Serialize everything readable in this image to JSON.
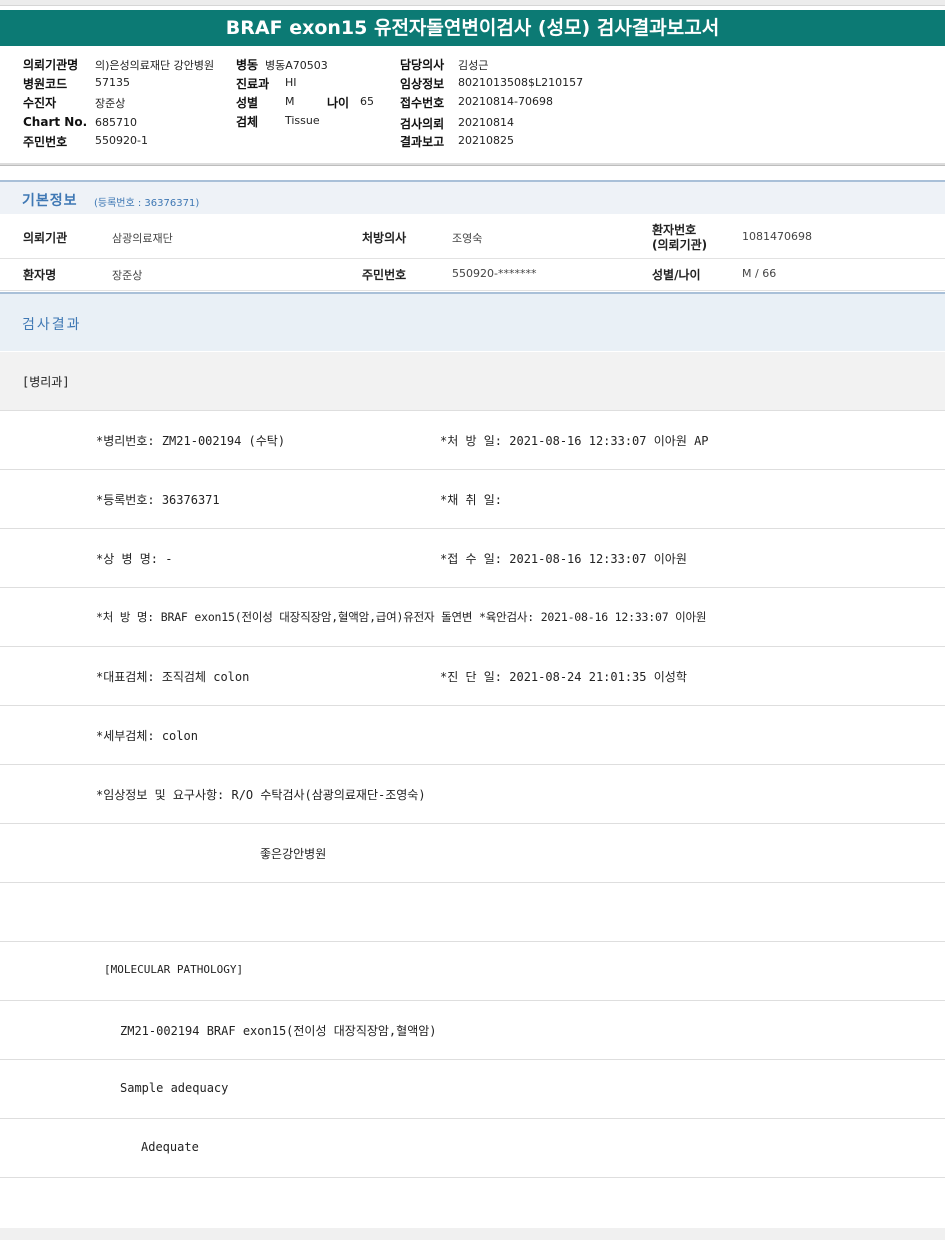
{
  "title": "BRAF exon15 유전자돌연변이검사 (성모) 검사결과보고서",
  "header": {
    "inst_label": "의뢰기관명",
    "inst_value": "의)은성의료재단 강안병원",
    "ward_label": "병동",
    "ward_value": "병동A70503",
    "doctor_label": "담당의사",
    "doctor_value": "김성근",
    "hospcode_label": "병원코드",
    "hospcode_value": "57135",
    "dept_label": "진료과",
    "dept_value": "HI",
    "clinical_label": "임상정보",
    "clinical_value": "8021013508$L210157",
    "patient_label": "수진자",
    "patient_value": "장준상",
    "sex_label": "성별",
    "sex_value": "M",
    "age_label": "나이",
    "age_value": "65",
    "receipt_label": "접수번호",
    "receipt_value": "20210814-70698",
    "chart_label": "Chart No.",
    "chart_value": "685710",
    "specimen_label": "검체",
    "specimen_value": "Tissue",
    "request_label": "검사의뢰",
    "request_value": "20210814",
    "rrn_label": "주민번호",
    "rrn_value": "550920-1",
    "report_label": "결과보고",
    "report_value": "20210825"
  },
  "basic": {
    "title": "기본정보",
    "reg_no": "(등록번호 : 36376371)",
    "req_inst_label": "의뢰기관",
    "req_inst_value": "삼광의료재단",
    "presc_doc_label": "처방의사",
    "presc_doc_value": "조영숙",
    "patient_no_label_1": "환자번호",
    "patient_no_label_2": "(의뢰기관)",
    "patient_no_value": "1081470698",
    "patient_name_label": "환자명",
    "patient_name_value": "장준상",
    "rrn_label": "주민번호",
    "rrn_value": "550920-*******",
    "sexage_label": "성별/나이",
    "sexage_value": "M / 66"
  },
  "results": {
    "title": "검사결과",
    "lines": [
      {
        "a": "[병리과]",
        "b": ""
      },
      {
        "a": "*병리번호: ZM21-002194 (수탁)",
        "b": "*처 방 일: 2021-08-16 12:33:07  이아원 AP"
      },
      {
        "a": "*등록번호: 36376371",
        "b": "*채 취 일:"
      },
      {
        "a": "*상 병 명: -",
        "b": "*접 수 일: 2021-08-16 12:33:07  이아원"
      },
      {
        "a": "*처 방 명: BRAF exon15(전이성 대장직장암,혈액암,급여)유전자 돌연변  *육안검사: 2021-08-16 12:33:07  이아원",
        "b": ""
      },
      {
        "a": "*대표검체: 조직검체 colon",
        "b": "*진 단 일: 2021-08-24 21:01:35  이성학"
      },
      {
        "a": "*세부검체: colon",
        "b": ""
      },
      {
        "a": "*임상정보 및 요구사항: R/O 수탁검사(삼광의료재단-조영숙)",
        "b": ""
      },
      {
        "a": "좋은강안병원",
        "b": ""
      },
      {
        "a": "",
        "b": ""
      },
      {
        "a": "[MOLECULAR PATHOLOGY]",
        "b": ""
      },
      {
        "a": "ZM21-002194     BRAF exon15(전이성 대장직장암,혈액암)",
        "b": ""
      },
      {
        "a": "Sample adequacy",
        "b": ""
      },
      {
        "a": "Adequate",
        "b": ""
      }
    ]
  }
}
